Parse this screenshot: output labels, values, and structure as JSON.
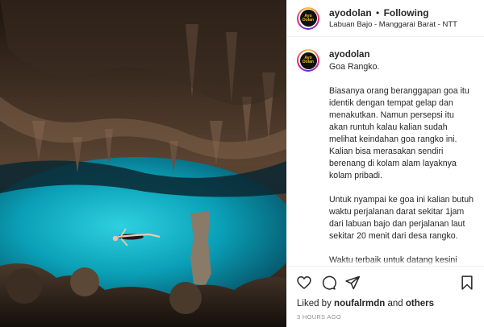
{
  "header": {
    "username": "ayodolan",
    "separator": "•",
    "follow_status": "Following",
    "location": "Labuan Bajo - Manggarai Barat - NTT"
  },
  "avatar": {
    "logo_line1": "Ayo",
    "logo_line2": "Dolan"
  },
  "caption": {
    "username": "ayodolan",
    "title": "Goa Rangko.",
    "paragraphs": [
      "Biasanya orang beranggapan goa itu identik dengan tempat gelap dan menakutkan. Namun persepsi itu akan runtuh kalau kalian sudah melihat keindahan goa rangko ini. Kalian bisa merasakan sendiri berenang di kolam alam layaknya kolam pribadi.",
      "Untuk nyampai ke goa ini kalian butuh waktu perjalanan darat sekitar 1jam dari labuan bajo dan perjalanan laut sekitar 20 menit dari desa rangko.",
      "Waktu terbaik untuk datang kesini adalah siang hari sekitar pukul"
    ]
  },
  "likes": {
    "prefix": "Liked by",
    "user": "noufalrmdn",
    "joiner": "and",
    "others": "others"
  },
  "timestamp": "3 HOURS AGO",
  "icons": {
    "like": "heart-icon",
    "comment": "comment-icon",
    "share": "share-icon",
    "save": "bookmark-icon"
  },
  "colors": {
    "water": "#0aa0b8",
    "cave_rock": "#3a2d22",
    "text": "#262626",
    "muted": "#8e8e8e",
    "divider": "#efefef"
  }
}
